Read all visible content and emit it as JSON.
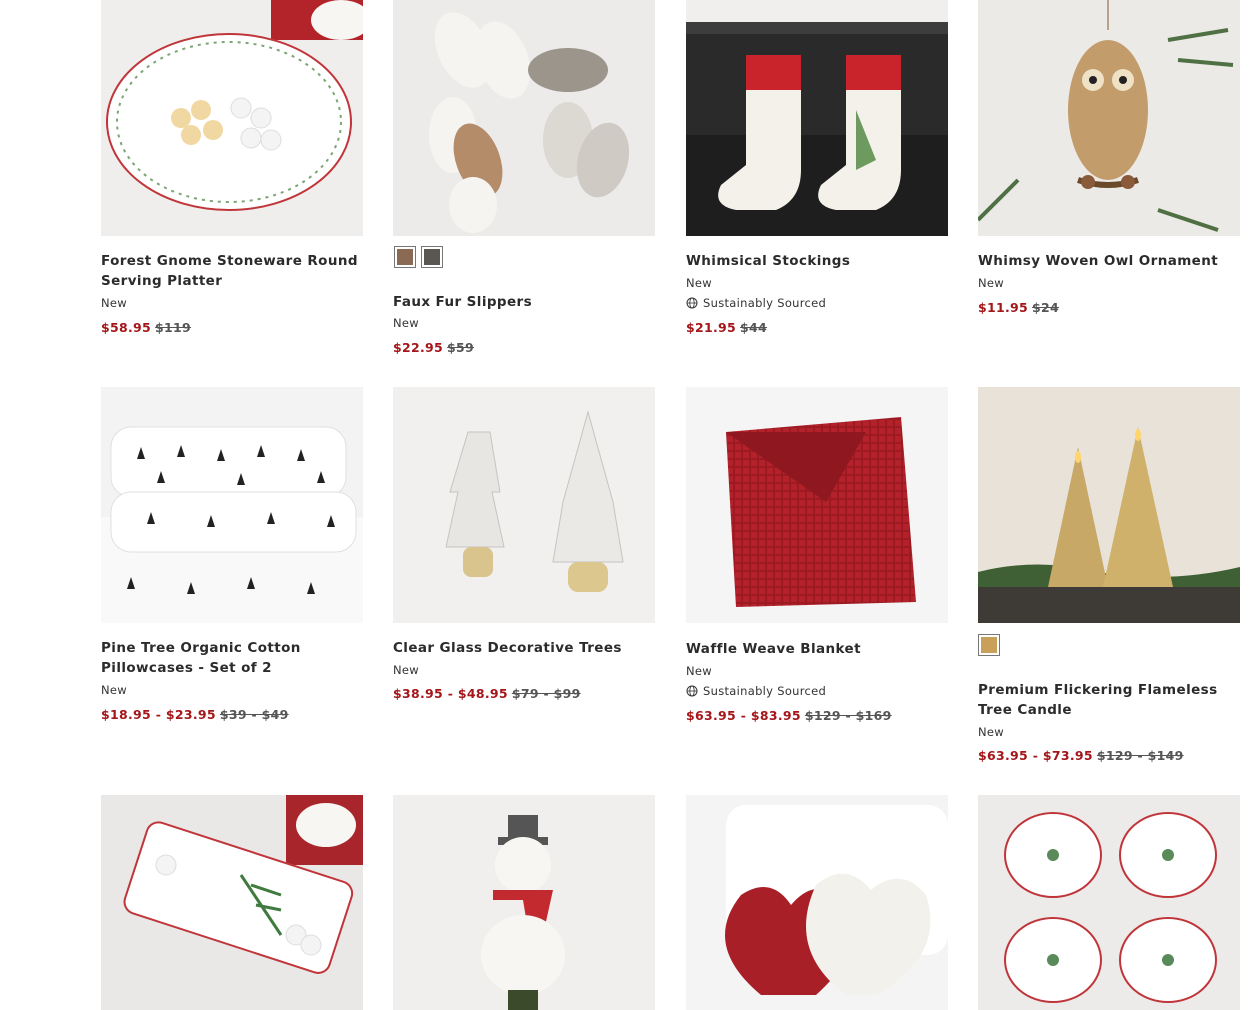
{
  "colors": {
    "sale": "#a4161a",
    "text": "#2b2b2b"
  },
  "products": [
    {
      "title": "Forest Gnome Stoneware Round Serving Platter",
      "badge": "New",
      "sale": "$58.95",
      "orig": "$119"
    },
    {
      "title": "Faux Fur Slippers",
      "badge": "New",
      "sale": "$22.95",
      "orig": "$59",
      "swatches": [
        "#8a6a52",
        "#5a5752"
      ]
    },
    {
      "title": "Whimsical Stockings",
      "badge": "New",
      "sustainable": "Sustainably Sourced",
      "sale": "$21.95",
      "orig": "$44"
    },
    {
      "title": "Whimsy Woven Owl Ornament",
      "badge": "New",
      "sale": "$11.95",
      "orig": "$24"
    },
    {
      "title": "Pine Tree Organic Cotton Pillowcases - Set of 2",
      "badge": "New",
      "sale": "$18.95 - $23.95",
      "orig": "$39 - $49"
    },
    {
      "title": "Clear Glass Decorative Trees",
      "badge": "New",
      "sale": "$38.95 - $48.95",
      "orig": "$79 - $99"
    },
    {
      "title": "Waffle Weave Blanket",
      "badge": "New",
      "sustainable": "Sustainably Sourced",
      "sale": "$63.95 - $83.95",
      "orig": "$129 - $169"
    },
    {
      "title": "Premium Flickering Flameless Tree Candle",
      "badge": "New",
      "sale": "$63.95 - $73.95",
      "orig": "$129 - $149",
      "swatches": [
        "#c8a05a"
      ]
    }
  ]
}
